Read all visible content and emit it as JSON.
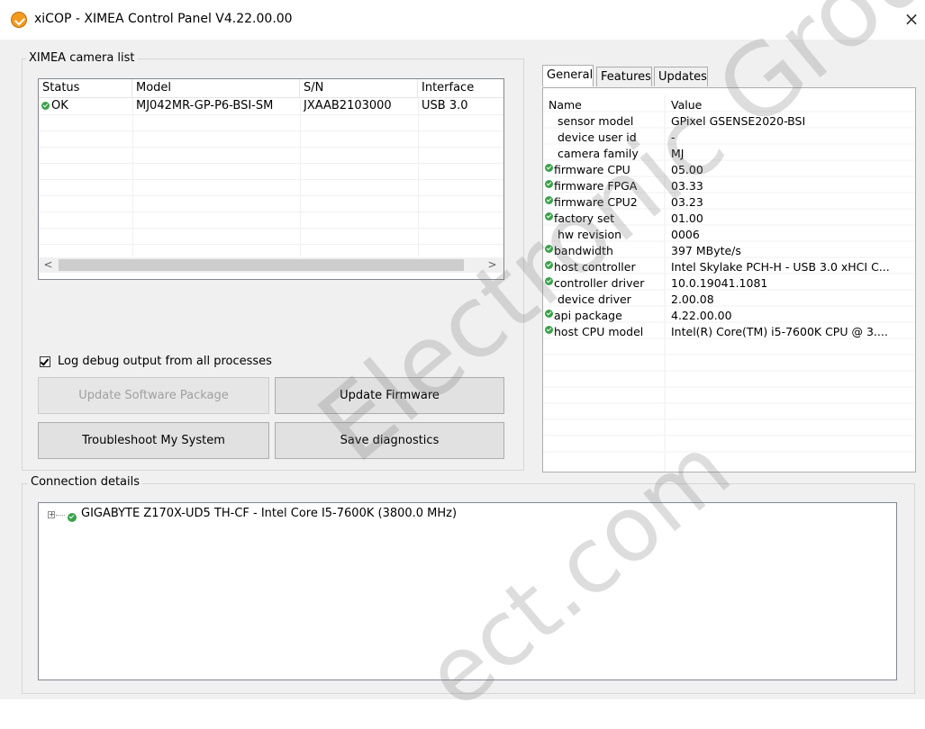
{
  "window": {
    "title": "xiCOP - XIMEA Control Panel V4.22.00.00",
    "close_glyph": "×"
  },
  "camera_list": {
    "legend": "XIMEA camera list",
    "columns": [
      "Status",
      "Model",
      "S/N",
      "Interface"
    ],
    "rows": [
      {
        "status": "OK",
        "model": "MJ042MR-GP-P6-BSI-SM",
        "sn": "JXAAB2103000",
        "interface": "USB 3.0"
      }
    ],
    "scroll_left": "<",
    "scroll_right": ">"
  },
  "log_debug": {
    "label": "Log debug output from all processes",
    "checked": true
  },
  "buttons": {
    "update_software": "Update Software Package",
    "update_firmware": "Update Firmware",
    "troubleshoot": "Troubleshoot My System",
    "save_diagnostics": "Save diagnostics"
  },
  "tabs": [
    {
      "label": "General",
      "active": true
    },
    {
      "label": "Features",
      "active": false
    },
    {
      "label": "Updates",
      "active": false
    }
  ],
  "properties": {
    "header_name": "Name",
    "header_value": "Value",
    "rows": [
      {
        "name": "sensor model",
        "value": "GPixel GSENSE2020-BSI",
        "ok": false
      },
      {
        "name": "device user id",
        "value": "-",
        "ok": false
      },
      {
        "name": "camera family",
        "value": "MJ",
        "ok": false
      },
      {
        "name": "firmware CPU",
        "value": "05.00",
        "ok": true
      },
      {
        "name": "firmware FPGA",
        "value": "03.33",
        "ok": true
      },
      {
        "name": "firmware CPU2",
        "value": "03.23",
        "ok": true
      },
      {
        "name": "factory set",
        "value": "01.00",
        "ok": true
      },
      {
        "name": "hw revision",
        "value": "0006",
        "ok": false
      },
      {
        "name": "bandwidth",
        "value": "397 MByte/s",
        "ok": true
      },
      {
        "name": "host controller",
        "value": "Intel Skylake PCH-H - USB 3.0 xHCI C...",
        "ok": true
      },
      {
        "name": "controller driver",
        "value": "10.0.19041.1081",
        "ok": true
      },
      {
        "name": "device driver",
        "value": "2.00.08",
        "ok": false
      },
      {
        "name": "api package",
        "value": "4.22.00.00",
        "ok": true
      },
      {
        "name": "host CPU model",
        "value": "Intel(R) Core(TM) i5-7600K CPU @ 3....",
        "ok": true
      }
    ]
  },
  "connection": {
    "legend": "Connection details",
    "expander": "+",
    "root_node": "GIGABYTE Z170X-UD5 TH-CF - Intel Core I5-7600K (3800.0 MHz)"
  },
  "watermark": {
    "line1": "Electronic Group",
    "line2": "ect.com"
  },
  "colors": {
    "ok_green": "#3aa24a",
    "app_icon": "#f29a1e"
  }
}
